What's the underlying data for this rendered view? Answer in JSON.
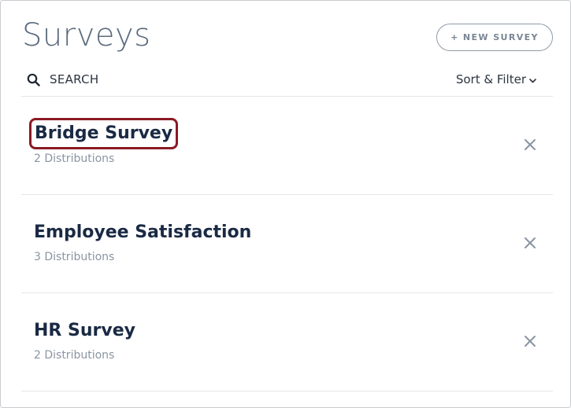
{
  "header": {
    "title": "Surveys",
    "new_button_label": "+ NEW SURVEY"
  },
  "toolbar": {
    "search_label": "SEARCH",
    "search_icon": "search-icon",
    "sort_label": "Sort & Filter",
    "sort_icon": "chevron-down-icon"
  },
  "surveys": [
    {
      "name": "Bridge Survey",
      "distributions": "2 Distributions",
      "highlighted": true
    },
    {
      "name": "Employee Satisfaction",
      "distributions": "3 Distributions",
      "highlighted": false
    },
    {
      "name": "HR Survey",
      "distributions": "2 Distributions",
      "highlighted": false
    }
  ],
  "colors": {
    "title": "#5b6b7e",
    "survey_name": "#1a2a44",
    "subtext": "#8a95a2",
    "highlight_outline": "#8b1a23",
    "close_icon": "#8a95a2"
  }
}
